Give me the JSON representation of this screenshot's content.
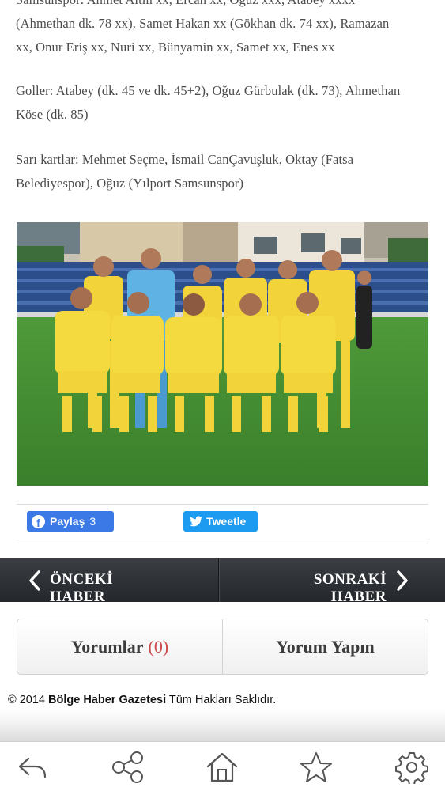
{
  "article": {
    "players_lines": [
      "Samsunspor: Ahmet Altın xx, Ercan xx, Oğuz xxx, Atabey xxxx",
      "(Ahmethan dk. 78 xx), Samet Hakan xx (Gökhan dk. 74 xx), Ramazan",
      "xx, Onur Eriş xx, Nuri xx, Bünyamin xx, Samet xx, Enes xx"
    ],
    "goals_lines": [
      "Goller: Atabey (dk. 45 ve dk. 45+2), Oğuz Gürbulak (dk. 73), Ahmethan",
      "Köse (dk. 85)"
    ],
    "cards_lines": [
      "Sarı kartlar: Mehmet Seçme, İsmail CanÇavuşluk, Oktay (Fatsa",
      "Belediyespor), Oğuz (Yılport Samsunspor)"
    ]
  },
  "share": {
    "facebook_label": "Paylaş",
    "facebook_count": "3",
    "twitter_label": "Tweetle"
  },
  "pager": {
    "prev_line1": "ÖNCEKİ",
    "prev_line2": "HABER",
    "next_line1": "SONRAKİ",
    "next_line2": "HABER"
  },
  "comments": {
    "comments_label": "Yorumlar",
    "comments_count": "(0)",
    "write_label": "Yorum Yapın"
  },
  "footer": {
    "copyright_prefix": "© 2014",
    "brand": "Bölge Haber Gazetesi",
    "rights": "Tüm Hakları Saklıdır."
  },
  "icons": {
    "back": "back-arrow-icon",
    "share": "share-icon",
    "home": "home-icon",
    "bookmark": "star-icon",
    "settings": "gear-icon"
  },
  "colors": {
    "facebook": "#3b79e6",
    "twitter": "#1d9bf0",
    "pager_bg": "#2c2f33",
    "comment_count": "#c94b4b",
    "jersey": "#f2d43a",
    "pitch": "#3f8a32"
  }
}
